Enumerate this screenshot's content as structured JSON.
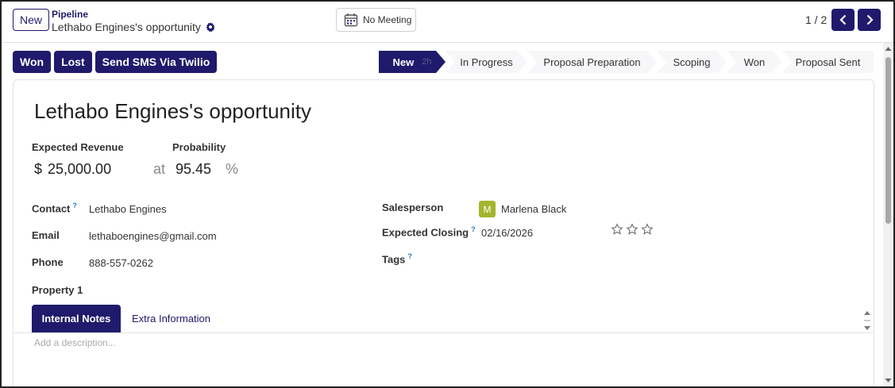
{
  "header": {
    "new_label": "New",
    "breadcrumb_parent": "Pipeline",
    "breadcrumb_current": "Lethabo Engines's opportunity",
    "meeting_label": "No Meeting",
    "pager_value": "1 / 2"
  },
  "actions": {
    "won": "Won",
    "lost": "Lost",
    "sms": "Send SMS Via Twilio"
  },
  "stages": [
    {
      "label": "New",
      "duration": "2h",
      "active": true
    },
    {
      "label": "In Progress"
    },
    {
      "label": "Proposal Preparation"
    },
    {
      "label": "Scoping"
    },
    {
      "label": "Won"
    },
    {
      "label": "Proposal Sent"
    }
  ],
  "form": {
    "title": "Lethabo Engines's opportunity",
    "expected_revenue_label": "Expected Revenue",
    "probability_label": "Probability",
    "currency": "$",
    "expected_revenue": "25,000.00",
    "at": "at",
    "probability": "95.45",
    "percent": "%",
    "contact_label": "Contact",
    "contact_help": "?",
    "contact": "Lethabo Engines",
    "email_label": "Email",
    "email": "lethaboengines@gmail.com",
    "phone_label": "Phone",
    "phone": "888-557-0262",
    "property_label": "Property 1",
    "salesperson_label": "Salesperson",
    "salesperson_initial": "M",
    "salesperson": "Marlena Black",
    "closing_label": "Expected Closing",
    "closing_help": "?",
    "closing": "02/16/2026",
    "priority_stars": 0,
    "tags_label": "Tags",
    "tags_help": "?"
  },
  "tabs": {
    "active": "Internal Notes",
    "other": "Extra Information",
    "description_placeholder": "Add a description..."
  },
  "colors": {
    "primary": "#1f1a6b",
    "avatar": "#a3b52d",
    "help": "#2a7bbf"
  }
}
